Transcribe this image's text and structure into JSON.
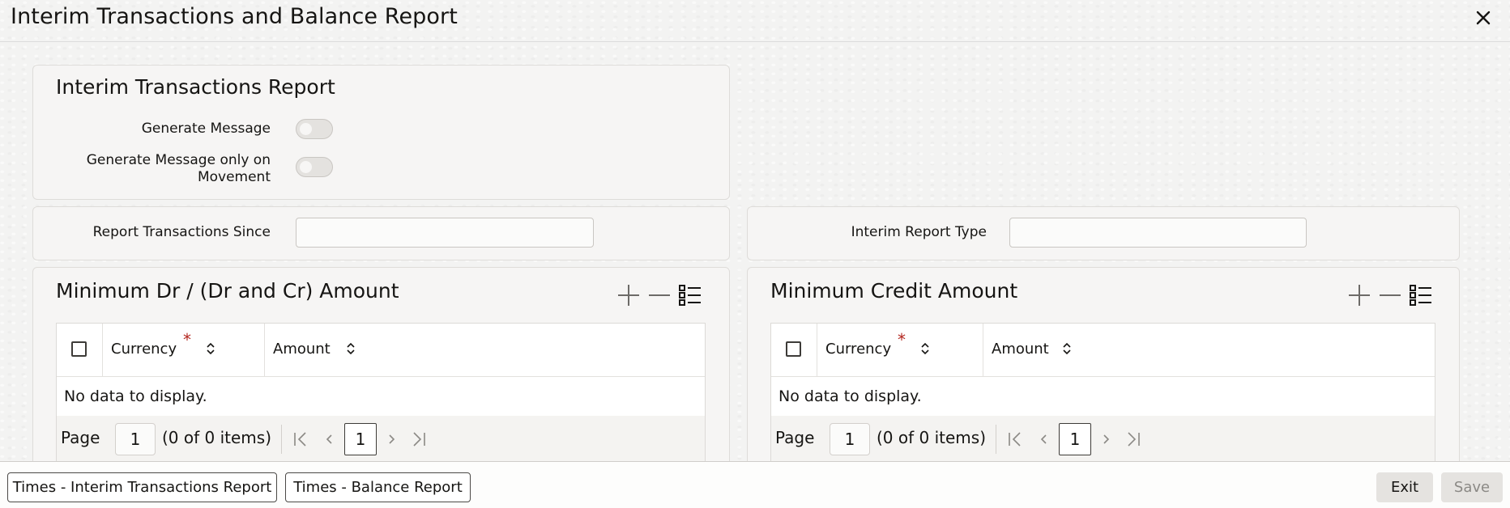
{
  "window": {
    "title": "Interim Transactions and Balance Report"
  },
  "interim_section": {
    "title": "Interim Transactions Report",
    "generate_message_label": "Generate Message",
    "generate_message_movement_label": "Generate Message only on Movement",
    "generate_message_on": false,
    "generate_message_movement_on": false
  },
  "report_fields": {
    "transactions_since_label": "Report Transactions Since",
    "transactions_since_value": "",
    "interim_report_type_label": "Interim Report Type",
    "interim_report_type_value": ""
  },
  "min_dr_grid": {
    "title": "Minimum Dr / (Dr and Cr) Amount",
    "columns": [
      "Currency",
      "Amount"
    ],
    "required_marker": "*",
    "empty_text": "No data to display.",
    "page_label": "Page",
    "page_value": "1",
    "items_text": "(0 of 0 items)",
    "current_page": "1"
  },
  "min_cr_grid": {
    "title": "Minimum Credit Amount",
    "columns": [
      "Currency",
      "Amount"
    ],
    "required_marker": "*",
    "empty_text": "No data to display.",
    "page_label": "Page",
    "page_value": "1",
    "items_text": "(0 of 0 items)",
    "current_page": "1"
  },
  "footer": {
    "times_interim_label": "Times - Interim Transactions Report",
    "times_balance_label": "Times - Balance Report",
    "exit_label": "Exit",
    "save_label": "Save"
  },
  "icons": [
    "close-icon",
    "add-icon",
    "remove-icon",
    "list-icon",
    "sort-icon",
    "first-page-icon",
    "prev-page-icon",
    "next-page-icon",
    "last-page-icon"
  ],
  "colors": {
    "required": "#b3261e",
    "text": "#161513",
    "disabled_text": "#8b8985"
  }
}
